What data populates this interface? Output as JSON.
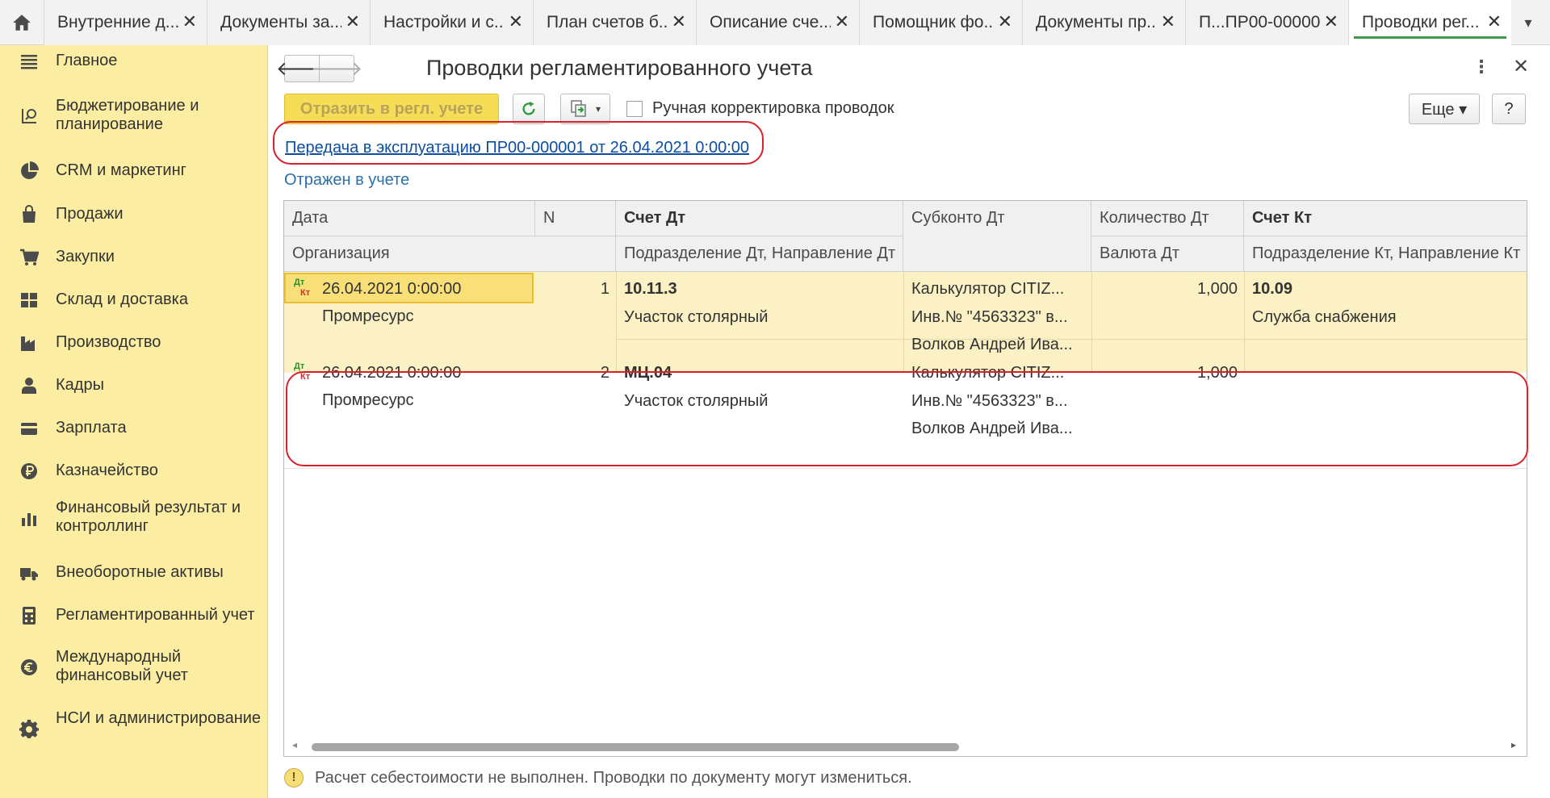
{
  "tabs": [
    {
      "label": "Внутренние д...",
      "active": false
    },
    {
      "label": "Документы за...",
      "active": false
    },
    {
      "label": "Настройки и с...",
      "active": false
    },
    {
      "label": "План счетов б...",
      "active": false
    },
    {
      "label": "Описание сче...",
      "active": false
    },
    {
      "label": "Помощник фо...",
      "active": false
    },
    {
      "label": "Документы пр...",
      "active": false
    },
    {
      "label": "П...ПР00-000001",
      "active": false
    },
    {
      "label": "Проводки рег...",
      "active": true
    }
  ],
  "sidebar": {
    "items": [
      {
        "label": "Главное",
        "icon": "menu-icon"
      },
      {
        "label": "Бюджетирование и планирование",
        "icon": "budget-icon"
      },
      {
        "label": "CRM и маркетинг",
        "icon": "pie-chart-icon"
      },
      {
        "label": "Продажи",
        "icon": "shopping-bag-icon"
      },
      {
        "label": "Закупки",
        "icon": "cart-icon"
      },
      {
        "label": "Склад и доставка",
        "icon": "warehouse-icon"
      },
      {
        "label": "Производство",
        "icon": "factory-icon"
      },
      {
        "label": "Кадры",
        "icon": "person-icon"
      },
      {
        "label": "Зарплата",
        "icon": "wallet-icon"
      },
      {
        "label": "Казначейство",
        "icon": "ruble-icon"
      },
      {
        "label": "Финансовый результат и контроллинг",
        "icon": "bar-chart-icon"
      },
      {
        "label": "Внеоборотные активы",
        "icon": "truck-icon"
      },
      {
        "label": "Регламентированный учет",
        "icon": "calculator-icon"
      },
      {
        "label": "Международный финансовый учет",
        "icon": "euro-icon"
      },
      {
        "label": "НСИ и администрирование",
        "icon": "gear-icon"
      }
    ]
  },
  "header": {
    "title": "Проводки регламентированного учета",
    "back_label": "🡐",
    "forward_label": "🡒",
    "kebab_label": "⋮",
    "close_label": "✕"
  },
  "toolbar": {
    "post_label": "Отразить в регл. учете",
    "manual_label": "Ручная корректировка проводок",
    "manual_checked": false,
    "more_label": "Еще ▾",
    "help_label": "?"
  },
  "document": {
    "link_text": "Передача в эксплуатацию ПР00-000001 от 26.04.2021 0:00:00",
    "status_text": "Отражен в учете"
  },
  "grid": {
    "headers": {
      "date": "Дата",
      "n": "N",
      "account_dt": "Счет Дт",
      "subconto_dt": "Субконто Дт",
      "qty_dt": "Количество Дт",
      "account_kt": "Счет Кт",
      "organization": "Организация",
      "division_dt": "Подразделение Дт, Направление Дт",
      "currency_dt": "Валюта Дт",
      "division_kt": "Подразделение Кт, Направление Кт"
    },
    "rows": [
      {
        "icon_dt": "Дт",
        "icon_kt": "Кт",
        "date": "26.04.2021 0:00:00",
        "n": "1",
        "account_dt": "10.11.3",
        "subconto_1": "Калькулятор CITIZ...",
        "subconto_2": "Инв.№ \"4563323\" в...",
        "subconto_3": "Волков Андрей Ива...",
        "qty_dt": "1,000",
        "account_kt": "10.09",
        "organization": "Промресурс",
        "division_dt": "Участок столярный",
        "division_kt": "Служба снабжения"
      },
      {
        "icon_dt": "Дт",
        "icon_kt": "Кт",
        "date": "26.04.2021 0:00:00",
        "n": "2",
        "account_dt": "МЦ.04",
        "subconto_1": "Калькулятор CITIZ...",
        "subconto_2": "Инв.№ \"4563323\" в...",
        "subconto_3": "Волков Андрей Ива...",
        "qty_dt": "1,000",
        "account_kt": "",
        "organization": "Промресурс",
        "division_dt": "Участок столярный",
        "division_kt": ""
      }
    ]
  },
  "warning": {
    "icon_label": "!",
    "text": "Расчет себестоимости не выполнен. Проводки по документу могут измениться."
  },
  "colors": {
    "sidebar_bg": "#fbeda2",
    "accent_yellow": "#f5de55",
    "selected_row": "#fbf1c4",
    "link_blue": "#0b4ea2",
    "highlight_red": "#d9212b",
    "active_tab_underline": "#3d9b4c"
  }
}
